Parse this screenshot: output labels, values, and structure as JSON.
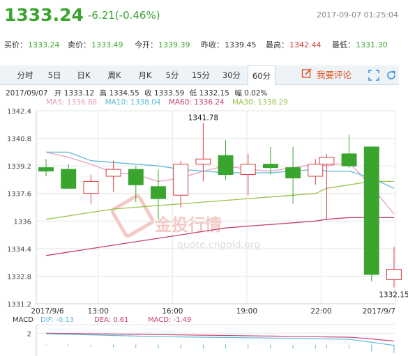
{
  "header": {
    "price": "1333.24",
    "change": "-6.21(-0.46%)",
    "timestamp": "2017-09-07 01:25:04"
  },
  "quotes": [
    {
      "label": "买价：",
      "value": "1333.24",
      "color": "green"
    },
    {
      "label": "卖价：",
      "value": "1333.49",
      "color": "green"
    },
    {
      "label": "今开：",
      "value": "1339.39",
      "color": "green"
    },
    {
      "label": "昨收：",
      "value": "1339.45",
      "color": "plain"
    },
    {
      "label": "最高：",
      "value": "1342.44",
      "color": "red"
    },
    {
      "label": "最低：",
      "value": "1331.30",
      "color": "green"
    }
  ],
  "tabs": [
    "分时",
    "5日",
    "日K",
    "周K",
    "月K",
    "5分",
    "15分",
    "30分",
    "60分"
  ],
  "active_tab": "60分",
  "comment_label": "我要评论",
  "ohlc_info": {
    "date": "2017/09/07",
    "open_label": "开",
    "open": "1333.12",
    "high_label": "高",
    "high": "1334.55",
    "close_label": "收",
    "close": "1333.59",
    "low_label": "低",
    "low": "1332.15",
    "amp_label": "幅",
    "amp": "0.02%"
  },
  "ma_legend": [
    {
      "label": "MA5: 1336.88",
      "color": "#e89fbf"
    },
    {
      "label": "MA10: 1338.04",
      "color": "#5bbbd6"
    },
    {
      "label": "MA60: 1336.24",
      "color": "#c8407a"
    },
    {
      "label": "MA30: 1338.29",
      "color": "#9ac24a"
    }
  ],
  "macd_legend": {
    "title": "MACD",
    "dif": "DIF: -0.13",
    "dea": "DEA: 0.61",
    "macd": "MACD: -1.49",
    "dif_color": "#5bbbd6",
    "dea_color": "#c8407a",
    "macd_color": "#c8407a"
  },
  "watermark": {
    "brand": "金投行情",
    "url": "quote.cngold.org"
  },
  "colors": {
    "up": "#d63b3b",
    "down": "#3aa52e",
    "grid": "#e6e6e6"
  },
  "chart_data": {
    "type": "candlestick",
    "ylim": [
      1331.2,
      1342.4
    ],
    "y_ticks": [
      "1342.4",
      "1340.8",
      "1339.2",
      "1337.6",
      "1336",
      "1334.4",
      "1332.8",
      "1331.2"
    ],
    "x_ticks": [
      {
        "index": 0,
        "label": "2017/9/6"
      },
      {
        "index": 5,
        "label": "13:00"
      },
      {
        "index": 11,
        "label": "16:00"
      },
      {
        "index": 17,
        "label": "19:00"
      },
      {
        "index": 23,
        "label": "22:00"
      },
      {
        "index": 29,
        "label": "2017/9/7"
      }
    ],
    "candles": [
      {
        "open": 1339.1,
        "high": 1339.6,
        "low": 1338.6,
        "close": 1338.9
      },
      {
        "open": 1339.0,
        "high": 1339.3,
        "low": 1337.9,
        "close": 1337.9
      },
      {
        "open": 1337.6,
        "high": 1338.7,
        "low": 1337.0,
        "close": 1338.3
      },
      {
        "open": 1338.6,
        "high": 1339.5,
        "low": 1337.7,
        "close": 1339.0
      },
      {
        "open": 1339.0,
        "high": 1339.2,
        "low": 1337.1,
        "close": 1338.1
      },
      {
        "open": 1338.0,
        "high": 1339.0,
        "low": 1336.1,
        "close": 1337.3
      },
      {
        "open": 1337.5,
        "high": 1339.5,
        "low": 1336.8,
        "close": 1339.3
      },
      {
        "open": 1339.3,
        "high": 1341.7,
        "low": 1338.3,
        "close": 1339.6
      },
      {
        "open": 1339.8,
        "high": 1340.7,
        "low": 1338.4,
        "close": 1338.7
      },
      {
        "open": 1338.7,
        "high": 1339.9,
        "low": 1337.5,
        "close": 1339.3
      },
      {
        "open": 1339.3,
        "high": 1340.3,
        "low": 1338.7,
        "close": 1339.1
      },
      {
        "open": 1339.1,
        "high": 1340.3,
        "low": 1337.0,
        "close": 1338.5
      },
      {
        "open": 1338.6,
        "high": 1339.6,
        "low": 1338.1,
        "close": 1339.3
      },
      {
        "open": 1339.3,
        "high": 1339.9,
        "low": 1336.1,
        "close": 1339.7
      },
      {
        "open": 1339.9,
        "high": 1341.0,
        "low": 1339.1,
        "close": 1339.2
      },
      {
        "open": 1340.3,
        "high": 1340.3,
        "low": 1332.5,
        "close": 1332.9
      },
      {
        "open": 1332.6,
        "high": 1334.5,
        "low": 1332.15,
        "close": 1333.2
      }
    ],
    "candle_slots": [
      0,
      2,
      4,
      6,
      8,
      10,
      12,
      14,
      16,
      18,
      20,
      22,
      24,
      25,
      27,
      29,
      31
    ],
    "high_marker": "1341.78",
    "low_marker": "1332.15",
    "ma_lines": {
      "MA5": [
        1340.0,
        1339.7,
        1339.3,
        1338.8,
        1338.7,
        1338.3,
        1338.5,
        1338.9,
        1339.2,
        1339.0,
        1338.9,
        1339.1,
        1339.3,
        1339.2,
        1339.4,
        1338.0,
        1336.4
      ],
      "MA10": [
        1340.0,
        1340.0,
        1339.5,
        1339.4,
        1339.3,
        1339.2,
        1339.0,
        1338.9,
        1338.8,
        1338.8,
        1338.8,
        1338.9,
        1339.0,
        1338.9,
        1338.9,
        1338.5,
        1337.9
      ],
      "MA30": [
        1336.1,
        1336.3,
        1336.5,
        1336.7,
        1336.8,
        1336.9,
        1337.0,
        1337.1,
        1337.2,
        1337.3,
        1337.4,
        1337.5,
        1337.6,
        1337.9,
        1338.1,
        1338.3,
        1338.3
      ],
      "MA60": [
        1334.0,
        1334.2,
        1334.4,
        1334.6,
        1334.8,
        1335.0,
        1335.2,
        1335.4,
        1335.6,
        1335.7,
        1335.8,
        1335.9,
        1336.0,
        1336.1,
        1336.2,
        1336.2,
        1336.2
      ]
    },
    "macd": {
      "ylim": [
        -2,
        3.5
      ],
      "y_ticks": [
        "2"
      ],
      "dif": [
        1.9,
        1.8,
        1.7,
        1.6,
        1.5,
        1.4,
        1.35,
        1.3,
        1.25,
        1.2,
        1.15,
        1.1,
        1.05,
        1.0,
        0.95,
        0.4,
        -0.13
      ],
      "dea": [
        2.0,
        1.95,
        1.9,
        1.85,
        1.8,
        1.75,
        1.7,
        1.65,
        1.6,
        1.55,
        1.5,
        1.45,
        1.4,
        1.35,
        1.3,
        1.0,
        0.61
      ],
      "bars": [
        -0.2,
        -0.3,
        -0.4,
        -0.5,
        -0.6,
        -0.7,
        -0.7,
        -0.7,
        -0.7,
        -0.7,
        -0.7,
        -0.7,
        -0.7,
        -0.7,
        -0.7,
        -1.2,
        -1.49
      ]
    }
  }
}
